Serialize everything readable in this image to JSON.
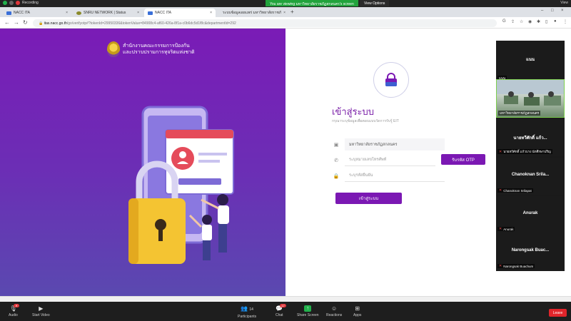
{
  "zoom_top": {
    "recording_label": "Recording",
    "share_banner": "You are viewing มหาวิทยาลัยราชภัฏสกลนคร's screen",
    "view_options": "View Options",
    "view_label": "View"
  },
  "browser": {
    "tabs": [
      {
        "label": "NACC ITA",
        "active": false
      },
      {
        "label": "SNRU NETWORK | Status",
        "active": false
      },
      {
        "label": "NACC ITA",
        "active": true
      },
      {
        "label": "ระบบข้อมูลเผยแพร่ มหาวิทยาลัยราชภั",
        "active": false
      }
    ],
    "url_host": "itas.nacc.go.th",
    "url_rest": "/go/verifyotp#?tokenId=29950336&tokenValue=84908c4-af60-426a-8f1a-c0b6dc5d1f8c&departmentId=292"
  },
  "hero": {
    "org_line1": "สำนักงานคณะกรรมการป้องกัน",
    "org_line2": "และปราบปรามการทุจริตแห่งชาติ"
  },
  "login": {
    "title": "เข้าสู่ระบบ",
    "subtitle": "กรุณาระบุข้อมูลเพื่อตอบแบบวัดการรับรู้ EIT",
    "org_value": "มหาวิทยาลัยราชภัฏสกลนคร",
    "phone_placeholder": "ระบุหมายเลขโทรศัพท์",
    "otp_button": "รับรหัส OTP",
    "otp_placeholder": "ระบุรหัสยืนยัน",
    "submit_button": "เข้าสู่ระบบ"
  },
  "gallery": {
    "tiles": [
      {
        "name": "แนน",
        "label": "แนน"
      },
      {
        "name": "",
        "label": "มหาวิทยาลัยราชภัฏสกลนคร",
        "video": true
      },
      {
        "name": "นายทวีศักดิ์ แก้ว...",
        "label": "นายทวีศักดิ์ แก้วบาง นักศึกษาปริญ"
      },
      {
        "name": "Chanoknan Srila...",
        "label": "Chanoknan Srilapat"
      },
      {
        "name": "Anurak",
        "label": "Anurak"
      },
      {
        "name": "Narongsak Buac...",
        "label": "Narongsak Buachum"
      }
    ]
  },
  "zoom_bottom": {
    "audio": "Audio",
    "start_video": "Start Video",
    "participants": "Participants",
    "participants_count": "14",
    "chat": "Chat",
    "chat_badge": "17",
    "share_screen": "Share Screen",
    "reactions": "Reactions",
    "apps": "Apps",
    "leave": "Leave"
  },
  "colors": {
    "brand_purple": "#7b18b3",
    "hero_top": "#7a1bb6",
    "hero_bottom": "#5a49b0",
    "zoom_green": "#21a33c",
    "leave_red": "#e0252b"
  }
}
